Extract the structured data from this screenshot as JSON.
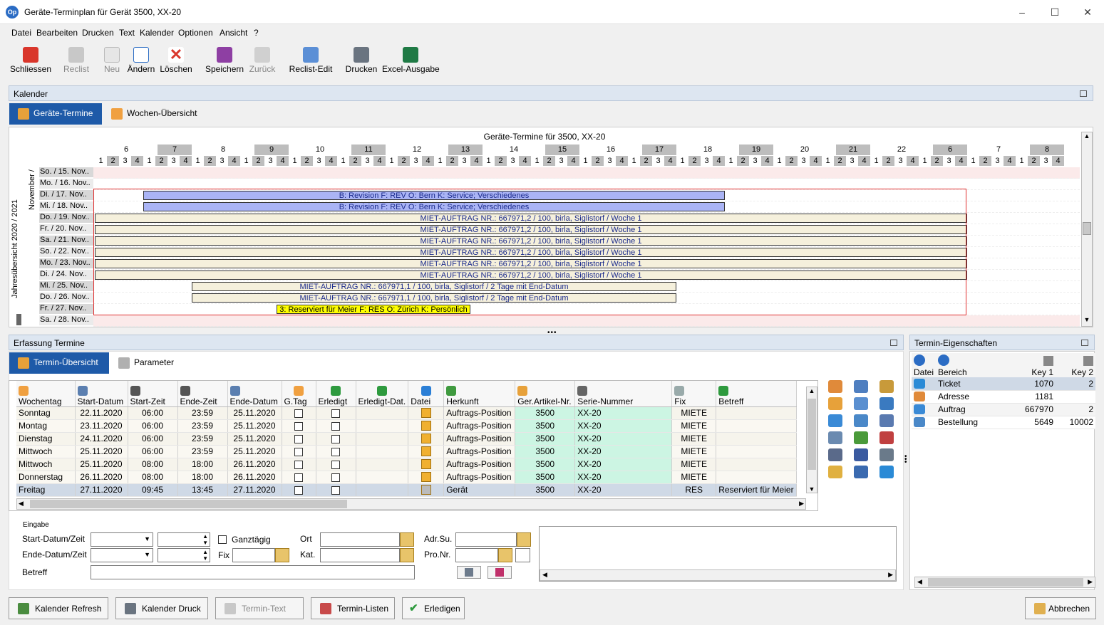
{
  "window": {
    "title": "Geräte-Terminplan für Gerät 3500, XX-20",
    "logo": "Op"
  },
  "menu": [
    "Datei",
    "Bearbeiten",
    "Drucken",
    "Text",
    "Kalender",
    "Optionen",
    "Ansicht",
    "?"
  ],
  "toolbar": [
    {
      "label": "Schliessen",
      "icon": "close-icon",
      "enabled": true
    },
    {
      "label": "Reclist",
      "icon": "folder-icon",
      "enabled": false
    },
    {
      "label": "Neu",
      "icon": "new-document-icon",
      "enabled": false
    },
    {
      "label": "Ändern",
      "icon": "edit-icon",
      "enabled": true
    },
    {
      "label": "Löschen",
      "icon": "delete-icon",
      "enabled": true
    },
    {
      "label": "Speichern",
      "icon": "save-icon",
      "enabled": true
    },
    {
      "label": "Zurück",
      "icon": "undo-icon",
      "enabled": false
    },
    {
      "label": "Reclist-Edit",
      "icon": "grid-edit-icon",
      "enabled": true
    },
    {
      "label": "Drucken",
      "icon": "printer-icon",
      "enabled": true
    },
    {
      "label": "Excel-Ausgabe",
      "icon": "excel-icon",
      "enabled": true
    }
  ],
  "kalender": {
    "panel_title": "Kalender",
    "tabs": [
      "Geräte-Termine",
      "Wochen-Übersicht"
    ],
    "chart_title": "Geräte-Termine für 3500, XX-20",
    "side_label_year": "Jahresübersicht 2020 / 2021",
    "side_label_month": "November /",
    "hours": [
      "6",
      "7",
      "8",
      "9",
      "10",
      "11",
      "12",
      "13",
      "14",
      "15",
      "16",
      "17",
      "18",
      "19",
      "20",
      "21",
      "22",
      "6",
      "7",
      "8"
    ],
    "quarters": [
      "1",
      "2",
      "3",
      "4"
    ],
    "rows": [
      "So. / 15. Nov..",
      "Mo. / 16. Nov..",
      "Di. / 17. Nov..",
      "Mi. / 18. Nov..",
      "Do. / 19. Nov..",
      "Fr. / 20. Nov..",
      "Sa. / 21. Nov..",
      "So. / 22. Nov..",
      "Mo. / 23. Nov..",
      "Di. / 24. Nov..",
      "Mi. / 25. Nov..",
      "Do. / 26. Nov..",
      "Fr. / 27. Nov..",
      "Sa. / 28. Nov.."
    ],
    "events": [
      {
        "row": 2,
        "text": "B: Revision F: REV O: Bern K: Service; Verschiedenes",
        "color": "#aab4f5",
        "start_hour": 7.0,
        "end_hour": 19.0
      },
      {
        "row": 3,
        "text": "B: Revision F: REV O: Bern K: Service; Verschiedenes",
        "color": "#aab4f5",
        "start_hour": 7.0,
        "end_hour": 19.0
      },
      {
        "row": 4,
        "text": "MIET-AUFTRAG NR.: 667971,2 / 100, birla, Siglistorf / Woche 1",
        "color": "#f5f0dc",
        "start_hour": 6.0,
        "end_hour": 24.0
      },
      {
        "row": 5,
        "text": "MIET-AUFTRAG NR.: 667971,2 / 100, birla, Siglistorf / Woche 1",
        "color": "#f5f0dc",
        "start_hour": 6.0,
        "end_hour": 24.0
      },
      {
        "row": 6,
        "text": "MIET-AUFTRAG NR.: 667971,2 / 100, birla, Siglistorf / Woche 1",
        "color": "#f5f0dc",
        "start_hour": 6.0,
        "end_hour": 24.0
      },
      {
        "row": 7,
        "text": "MIET-AUFTRAG NR.: 667971,2 / 100, birla, Siglistorf / Woche 1",
        "color": "#f5f0dc",
        "start_hour": 6.0,
        "end_hour": 24.0
      },
      {
        "row": 8,
        "text": "MIET-AUFTRAG NR.: 667971,2 / 100, birla, Siglistorf / Woche 1",
        "color": "#f5f0dc",
        "start_hour": 6.0,
        "end_hour": 24.0
      },
      {
        "row": 9,
        "text": "MIET-AUFTRAG NR.: 667971,2 / 100, birla, Siglistorf / Woche 1",
        "color": "#f5f0dc",
        "start_hour": 6.0,
        "end_hour": 24.0
      },
      {
        "row": 10,
        "text": "MIET-AUFTRAG NR.: 667971,1 / 100, birla, Siglistorf / 2 Tage mit End-Datum",
        "color": "#f5f0dc",
        "start_hour": 8.0,
        "end_hour": 18.0
      },
      {
        "row": 11,
        "text": "MIET-AUFTRAG NR.: 667971,1 / 100, birla, Siglistorf / 2 Tage mit End-Datum",
        "color": "#f5f0dc",
        "start_hour": 8.0,
        "end_hour": 18.0
      },
      {
        "row": 12,
        "text": "3: Reserviert für Meier F: RES O: Zürich K: Persönlich",
        "color": "#ffff00",
        "start_hour": 9.75,
        "end_hour": 13.75
      }
    ]
  },
  "erfassung": {
    "panel_title": "Erfassung Termine",
    "tabs": [
      "Termin-Übersicht",
      "Parameter"
    ],
    "columns": [
      "Wochentag",
      "Start-Datum",
      "Start-Zeit",
      "Ende-Zeit",
      "Ende-Datum",
      "G.Tag",
      "Erledigt",
      "Erledigt-Dat.",
      "Datei",
      "Herkunft",
      "Ger.Artikel-Nr.",
      "Serie-Nummer",
      "Fix",
      "Betreff"
    ],
    "rows": [
      {
        "wochentag": "Sonntag",
        "start_datum": "22.11.2020",
        "start_zeit": "06:00",
        "ende_zeit": "23:59",
        "ende_datum": "25.11.2020",
        "herkunft": "Auftrags-Position",
        "artikel": "3500",
        "serie": "XX-20",
        "fix": "MIETE",
        "betreff": ""
      },
      {
        "wochentag": "Montag",
        "start_datum": "23.11.2020",
        "start_zeit": "06:00",
        "ende_zeit": "23:59",
        "ende_datum": "25.11.2020",
        "herkunft": "Auftrags-Position",
        "artikel": "3500",
        "serie": "XX-20",
        "fix": "MIETE",
        "betreff": ""
      },
      {
        "wochentag": "Dienstag",
        "start_datum": "24.11.2020",
        "start_zeit": "06:00",
        "ende_zeit": "23:59",
        "ende_datum": "25.11.2020",
        "herkunft": "Auftrags-Position",
        "artikel": "3500",
        "serie": "XX-20",
        "fix": "MIETE",
        "betreff": ""
      },
      {
        "wochentag": "Mittwoch",
        "start_datum": "25.11.2020",
        "start_zeit": "06:00",
        "ende_zeit": "23:59",
        "ende_datum": "25.11.2020",
        "herkunft": "Auftrags-Position",
        "artikel": "3500",
        "serie": "XX-20",
        "fix": "MIETE",
        "betreff": ""
      },
      {
        "wochentag": "Mittwoch",
        "start_datum": "25.11.2020",
        "start_zeit": "08:00",
        "ende_zeit": "18:00",
        "ende_datum": "26.11.2020",
        "herkunft": "Auftrags-Position",
        "artikel": "3500",
        "serie": "XX-20",
        "fix": "MIETE",
        "betreff": ""
      },
      {
        "wochentag": "Donnerstag",
        "start_datum": "26.11.2020",
        "start_zeit": "08:00",
        "ende_zeit": "18:00",
        "ende_datum": "26.11.2020",
        "herkunft": "Auftrags-Position",
        "artikel": "3500",
        "serie": "XX-20",
        "fix": "MIETE",
        "betreff": ""
      },
      {
        "wochentag": "Freitag",
        "start_datum": "27.11.2020",
        "start_zeit": "09:45",
        "ende_zeit": "13:45",
        "ende_datum": "27.11.2020",
        "herkunft": "Gerät",
        "artikel": "3500",
        "serie": "XX-20",
        "fix": "RES",
        "betreff": "Reserviert für Meier",
        "selected": true
      }
    ]
  },
  "eingabe": {
    "group_title": "Eingabe",
    "start_label": "Start-Datum/Zeit",
    "ende_label": "Ende-Datum/Zeit",
    "betreff_label": "Betreff",
    "ganztaegig_label": "Ganztägig",
    "fix_label": "Fix",
    "ort_label": "Ort",
    "kat_label": "Kat.",
    "adrsu_label": "Adr.Su.",
    "pronr_label": "Pro.Nr."
  },
  "eigenschaften": {
    "panel_title": "Termin-Eigenschaften",
    "columns": [
      "Datei",
      "Bereich",
      "Key 1",
      "Key 2"
    ],
    "rows": [
      {
        "bereich": "Ticket",
        "key1": "1070",
        "key2": "2",
        "selected": true
      },
      {
        "bereich": "Adresse",
        "key1": "1181",
        "key2": ""
      },
      {
        "bereich": "Auftrag",
        "key1": "667970",
        "key2": "2"
      },
      {
        "bereich": "Bestellung",
        "key1": "5649",
        "key2": "10002"
      }
    ]
  },
  "bottom_buttons": [
    {
      "label": "Kalender Refresh",
      "enabled": true
    },
    {
      "label": "Kalender Druck",
      "enabled": true
    },
    {
      "label": "Termin-Text",
      "enabled": false
    },
    {
      "label": "Termin-Listen",
      "enabled": true
    },
    {
      "label": "Erledigen",
      "enabled": true
    }
  ],
  "abbrechen_label": "Abbrechen"
}
